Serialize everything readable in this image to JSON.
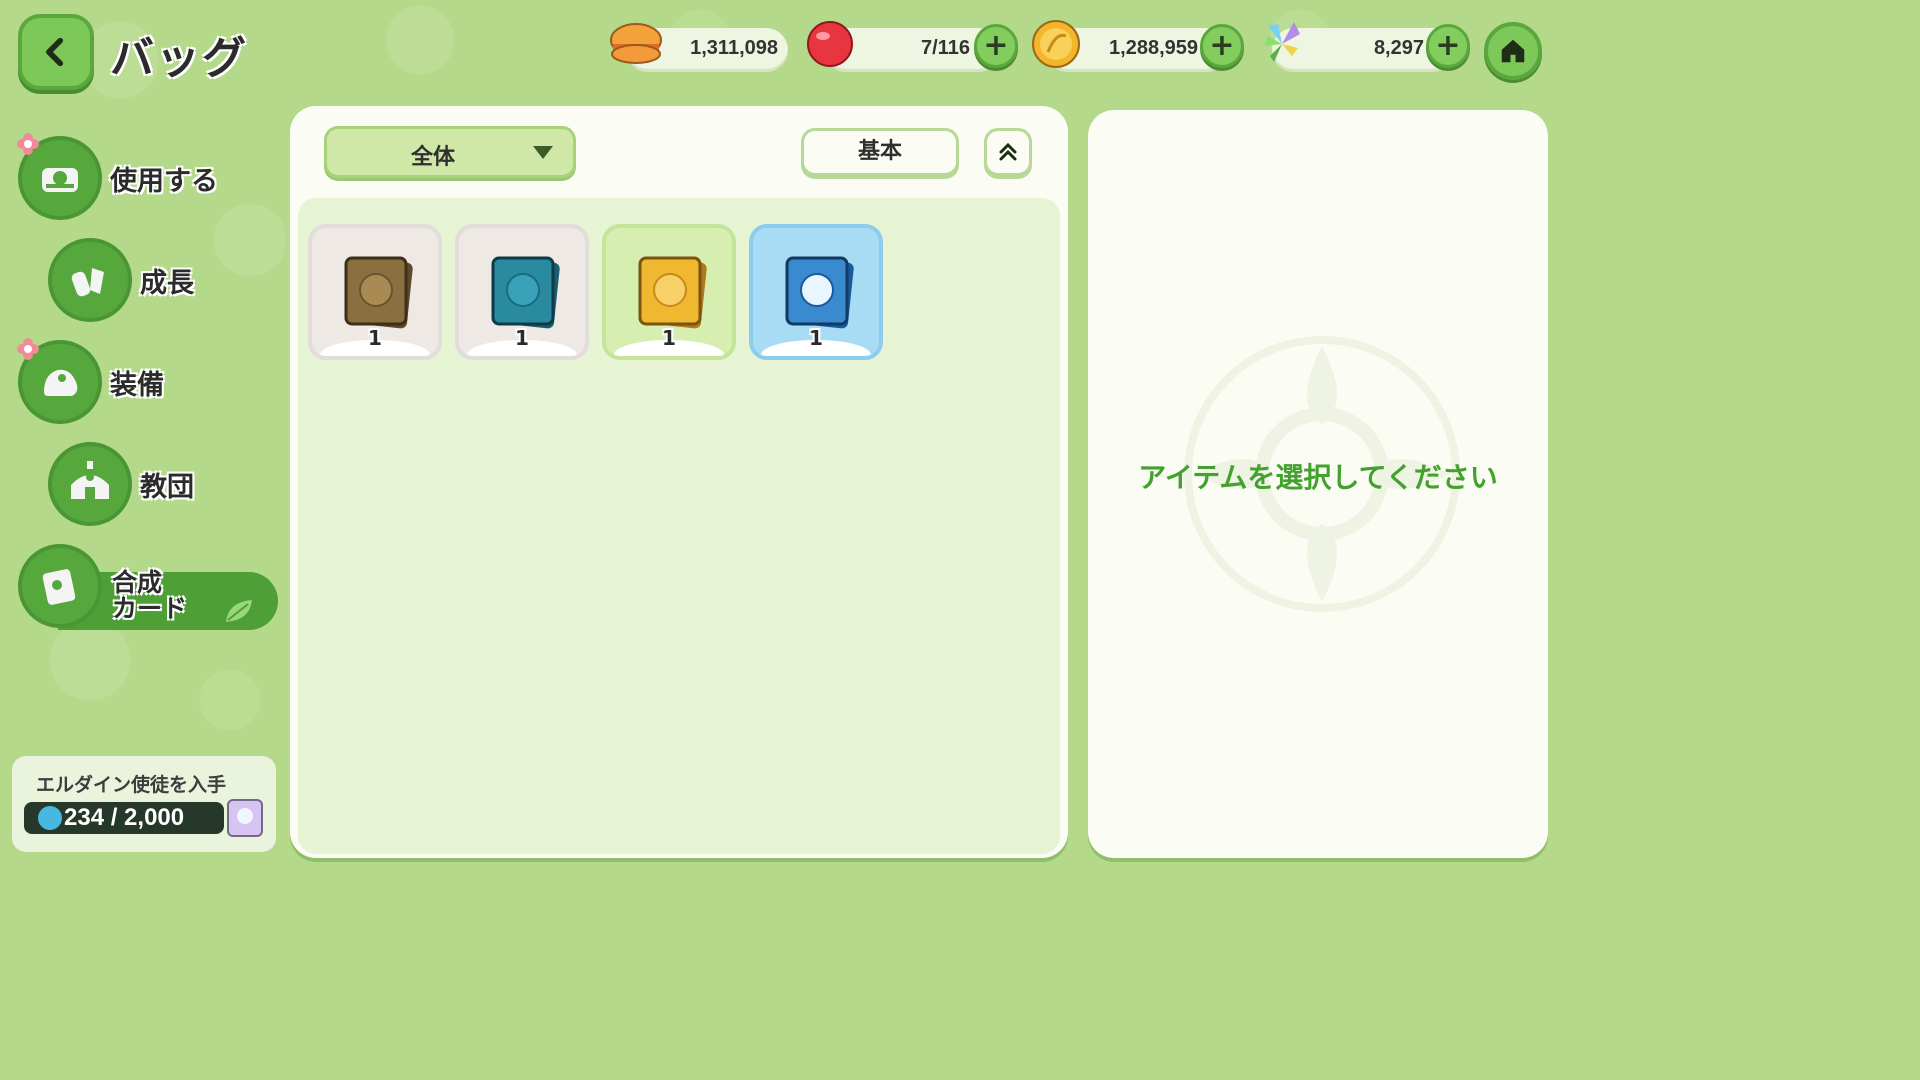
{
  "header": {
    "title": "バッグ",
    "currencies": [
      {
        "name": "burger-currency",
        "amount": "1,311,098",
        "has_plus": false
      },
      {
        "name": "candy-stamina",
        "amount": "7/116",
        "has_plus": true
      },
      {
        "name": "gold-coin",
        "amount": "1,288,959",
        "has_plus": true
      },
      {
        "name": "crystal-flower",
        "amount": "8,297",
        "has_plus": true
      }
    ],
    "plus_label": "+"
  },
  "sidebar": {
    "items": [
      {
        "label": "使用する",
        "icon": "chest-icon",
        "has_flower": true
      },
      {
        "label": "成長",
        "icon": "potion-icon",
        "has_flower": false
      },
      {
        "label": "装備",
        "icon": "equipment-icon",
        "has_flower": true
      },
      {
        "label": "教団",
        "icon": "building-icon",
        "has_flower": false
      }
    ],
    "active_item": {
      "label_line1": "合成",
      "label_line2": "カード",
      "icon": "card-icon"
    }
  },
  "progress": {
    "title": "エルダイン使徒を入手",
    "value_text": "234 / 2,000",
    "current": 234,
    "max": 2000
  },
  "main": {
    "filter_label": "全体",
    "sort_label": "基本",
    "items": [
      {
        "count": "1",
        "color": "#8a7040",
        "slot_bg": "#efe9e6"
      },
      {
        "count": "1",
        "color": "#2a8aa0",
        "slot_bg": "#efe9e6"
      },
      {
        "count": "1",
        "color": "#f0b830",
        "slot_bg": "#d6efb0"
      },
      {
        "count": "1",
        "color": "#3a8ad0",
        "slot_bg": "#a8dcf4"
      }
    ]
  },
  "detail": {
    "empty_message": "アイテムを選択してください"
  },
  "colors": {
    "accent_green": "#56a83d",
    "background": "#b5d98a",
    "message_green": "#43a12e"
  }
}
